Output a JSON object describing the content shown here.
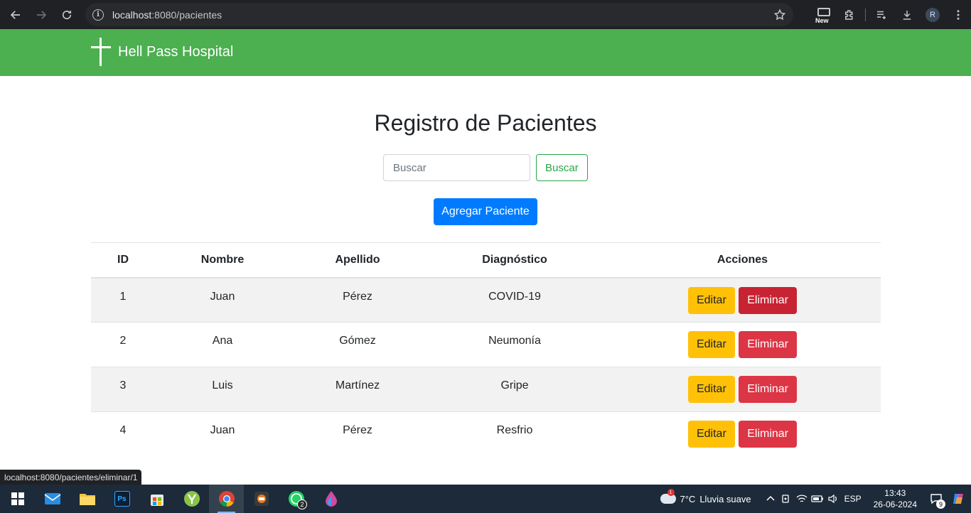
{
  "browser": {
    "url_host": "localhost",
    "url_path": ":8080/pacientes",
    "new_badge": "New",
    "profile_initial": "R"
  },
  "app": {
    "brand": "Hell Pass Hospital",
    "title": "Registro de Pacientes",
    "search_placeholder": "Buscar",
    "search_button": "Buscar",
    "add_button": "Agregar Paciente",
    "columns": [
      "ID",
      "Nombre",
      "Apellido",
      "Diagnóstico",
      "Acciones"
    ],
    "rows": [
      {
        "id": "1",
        "nombre": "Juan",
        "apellido": "Pérez",
        "diagnostico": "COVID-19"
      },
      {
        "id": "2",
        "nombre": "Ana",
        "apellido": "Gómez",
        "diagnostico": "Neumonía"
      },
      {
        "id": "3",
        "nombre": "Luis",
        "apellido": "Martínez",
        "diagnostico": "Gripe"
      },
      {
        "id": "4",
        "nombre": "Juan",
        "apellido": "Pérez",
        "diagnostico": "Resfrio"
      }
    ],
    "edit_label": "Editar",
    "delete_label": "Eliminar",
    "colors": {
      "navbar": "#4caf50",
      "primary": "#007bff",
      "warning": "#ffc107",
      "danger": "#dc3545",
      "success": "#28a745"
    }
  },
  "status_bar_url": "localhost:8080/pacientes/eliminar/1",
  "taskbar": {
    "weather_temp": "7°C",
    "weather_text": "Lluvia suave",
    "weather_alert": "1",
    "language": "ESP",
    "time": "13:43",
    "date": "26-06-2024",
    "whatsapp_badge": "2",
    "notifications": "9",
    "apps": [
      "windows-start-icon",
      "mail-icon",
      "file-explorer-icon",
      "photoshop-icon",
      "store-icon",
      "app-icon",
      "chrome-icon",
      "app-icon",
      "whatsapp-icon",
      "paint-icon"
    ]
  }
}
